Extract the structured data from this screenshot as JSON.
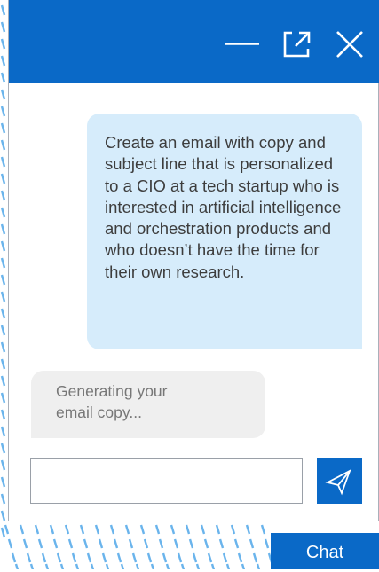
{
  "header": {
    "minimize_icon": "minimize-icon",
    "popout_icon": "popout-icon",
    "close_icon": "close-icon"
  },
  "messages": {
    "user": "Create an email with copy and subject line that is personalized to a CIO at a tech startup who is interested in artificial intelligence and orchestration products and who doesn’t have the time for their own research.",
    "bot": "Generating your\nemail copy..."
  },
  "composer": {
    "input_value": "",
    "send_icon": "send-icon"
  },
  "launcher": {
    "label": "Chat"
  },
  "colors": {
    "brand_blue": "#0a69c7",
    "user_bubble": "#d6ecfb",
    "bot_bubble": "#efefef",
    "pattern_line": "#6ab4ec"
  }
}
